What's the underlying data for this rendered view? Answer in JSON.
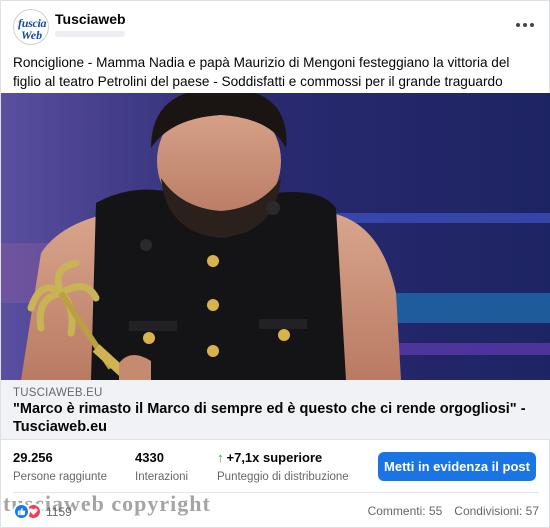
{
  "post": {
    "page_name": "Tusciaweb",
    "avatar_line1": "fuscia",
    "avatar_line2": "Web",
    "caption": "Ronciglione - Mamma Nadia e papà Maurizio di Mengoni festeggiano la vittoria del figlio al teatro Petrolini del paese - Soddisfatti e commossi per il grande traguardo raggiunto"
  },
  "link_preview": {
    "domain": "TUSCIAWEB.EU",
    "title": "\"Marco è rimasto il Marco di sempre ed è questo che ci rende orgogliosi\" - Tusciaweb.eu"
  },
  "insights": {
    "people_reached_value": "29.256",
    "people_reached_label": "Persone raggiunte",
    "interactions_value": "4330",
    "interactions_label": "Interazioni",
    "distribution_value": "+7,1x superiore",
    "distribution_label": "Punteggio di distribuzione",
    "boost_label": "Metti in evidenza il post"
  },
  "footer": {
    "reaction_count": "1159",
    "watermark": "tusciaweb copyright",
    "comments": "Commenti: 55",
    "shares": "Condivisioni: 57"
  },
  "icons": {
    "more": "more-horizontal-icon",
    "up_arrow": "arrow-up-icon",
    "like": "like-icon",
    "love": "love-icon"
  },
  "colors": {
    "accent": "#1b74e4",
    "positive": "#31a24c",
    "like": "#1877f2",
    "love": "#f33e58"
  }
}
